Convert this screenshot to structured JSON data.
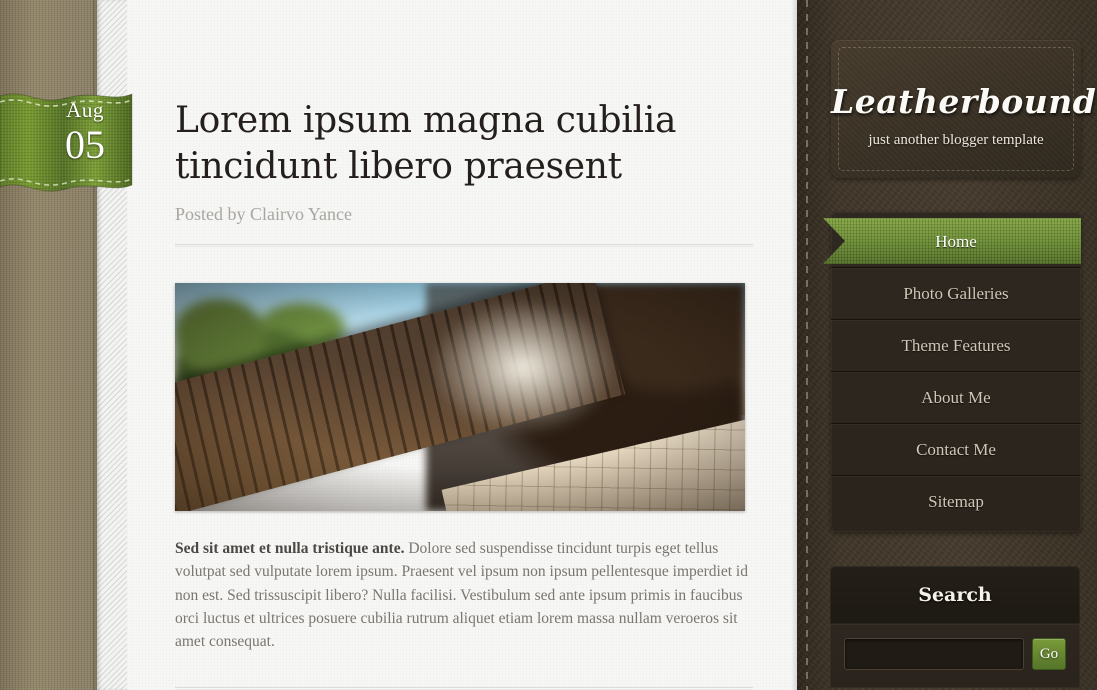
{
  "post": {
    "date": {
      "month": "Aug",
      "day": "05"
    },
    "title": "Lorem ipsum magna cubilia tincidunt libero praesent",
    "meta": "Posted by Clairvo Yance",
    "body_lead": "Sed sit amet et nulla tristique ante.",
    "body_rest": " Dolore sed suspendisse tincidunt turpis eget tellus volutpat sed vulputate lorem ipsum. Praesent vel ipsum non ipsum pellentesque imperdiet id non est. Sed trissuscipit libero? Nulla facilisi. Vestibulum sed ante ipsum primis in faucibus orci luctus et ultrices posuere cubilia rutrum aliquet etiam lorem massa nullam veroeros sit amet consequat.",
    "photo_alt": "tilt-shift photo of a paved pathway beside a weathered stone wall with green foliage and blue sky"
  },
  "sidebar": {
    "brand": {
      "title": "Leatherbound",
      "tagline": "just another blogger template"
    },
    "nav": {
      "items": [
        {
          "label": "Home",
          "active": true
        },
        {
          "label": "Photo Galleries",
          "active": false
        },
        {
          "label": "Theme Features",
          "active": false
        },
        {
          "label": "About Me",
          "active": false
        },
        {
          "label": "Contact Me",
          "active": false
        },
        {
          "label": "Sitemap",
          "active": false
        }
      ]
    },
    "search": {
      "heading": "Search",
      "value": "",
      "placeholder": "",
      "button_label": "Go"
    }
  },
  "colors": {
    "accent_green": "#6b8e31",
    "leather_dark": "#3a3126",
    "linen_tan": "#8f8369",
    "content_bg": "#f7f7f5",
    "title_text": "#241f1c",
    "body_text": "#7a756f"
  }
}
